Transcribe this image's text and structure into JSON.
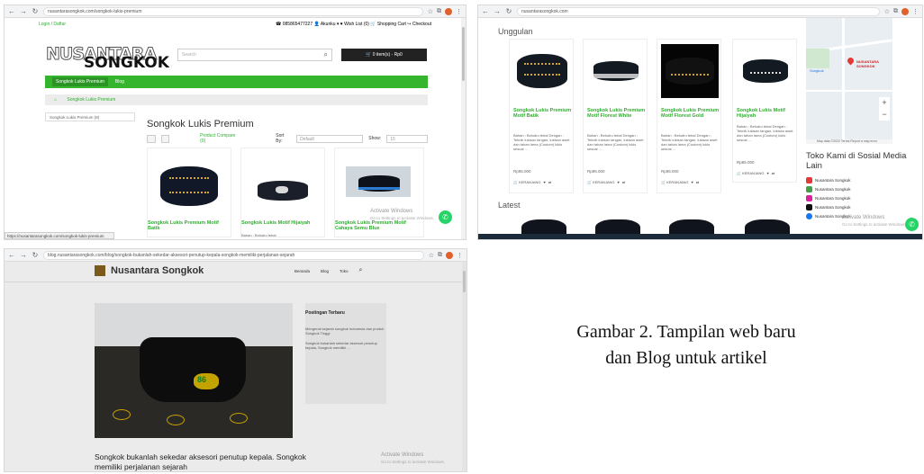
{
  "screen1": {
    "url": "nusantarasongkok.com/songkok-lukis-premium",
    "top_left": "Login / Daftar",
    "top_right": "☎ 085865477227   👤 Akunku ▾   ♥ Wish List (0)   🛒 Shopping Cart   ↪ Checkout",
    "logo_top": "NUSANTARA",
    "logo_bottom": "SONGKOK",
    "search_placeholder": "Search",
    "cart": "🛒 0 item(s) - Rp0",
    "nav": [
      "Songkok Lukis Premium",
      "Blog"
    ],
    "breadcrumb": "Songkok Lukis Premium",
    "side_category": "Songkok Lukis Premium (8)",
    "title": "Songkok Lukis Premium",
    "compare": "Product Compare (0)",
    "sort_label": "Sort By:",
    "sort_value": "Default",
    "show_label": "Show:",
    "show_value": "15",
    "products": [
      "Songkok Lukis Premium Motif Batik",
      "Songkok Lukis Motif Hijaiyah",
      "Songkok Lukis Premium Motif Cahaya Semu Blue"
    ],
    "product2_desc": "Bahan : Beludru tebal",
    "status": "https://nusantarasongkok.com/songkok-lukis-premium",
    "activate_title": "Activate Windows",
    "activate_sub": "Go to Settings to activate Windows."
  },
  "screen2": {
    "url": "nusantarasongkok.com",
    "featured": "Unggulan",
    "latest": "Latest",
    "products": [
      {
        "name": "Songkok Lukis Premium Motif Batik",
        "price": "Rp95.000"
      },
      {
        "name": "Songkok Lukis Premium Motif Florest White",
        "price": "Rp95.000"
      },
      {
        "name": "Songkok Lukis Premium Motif Florest Gold",
        "price": "Rp95.000"
      },
      {
        "name": "Songkok Lukis Motif Hijaiyah",
        "price": "Rp85.000"
      }
    ],
    "desc": "Bahan : Beludru tebal Dengan : Teknik lukisan tangan, lukisan awet dan tahan lama (Custom) lukis sesuai ...",
    "add_cart": "🛒 KERANJANG",
    "map_label": "NUSANTARA SONGKOK",
    "map_label2": "Songkok",
    "map_footer": "Map data ©2022   Terms   Report a map error",
    "toko": "Toko Kami di Sosial Media Lain",
    "social": [
      "Nusantara Songkok",
      "Nusantara Songkok",
      "Nusantara Songkok",
      "Nusantara Songkok",
      "Nusantara Songkok"
    ],
    "activate_title": "Activate Windows",
    "activate_sub": "Go to Settings to activate Windows."
  },
  "screen3": {
    "url": "blog.nusantarasongkok.com/blog/songkok-bukanlah-sekedar-aksesori-penutup-kepala-songkok-memiliki-perjalanan-sejarah",
    "blog_title": "Nusantara Songkok",
    "menu": [
      "Beranda",
      "Blog",
      "Toko"
    ],
    "hero_brand": "86",
    "sidebar_heading": "Postingan Terbaru",
    "sidebar_links": [
      "Mengenal sejarah songkok Indonesia dan produk Songkok Tinggi",
      "Songkok bukanlah sekedar aksesori penutup kepala, Songkok memiliki ..."
    ],
    "lead": "Songkok bukanlah sekedar aksesori penutup kepala. Songkok memiliki perjalanan sejarah",
    "activate_title": "Activate Windows",
    "activate_sub": "Go to Settings to activate Windows."
  },
  "caption": "Gambar 2. Tampilan web baru dan Blog untuk artikel"
}
